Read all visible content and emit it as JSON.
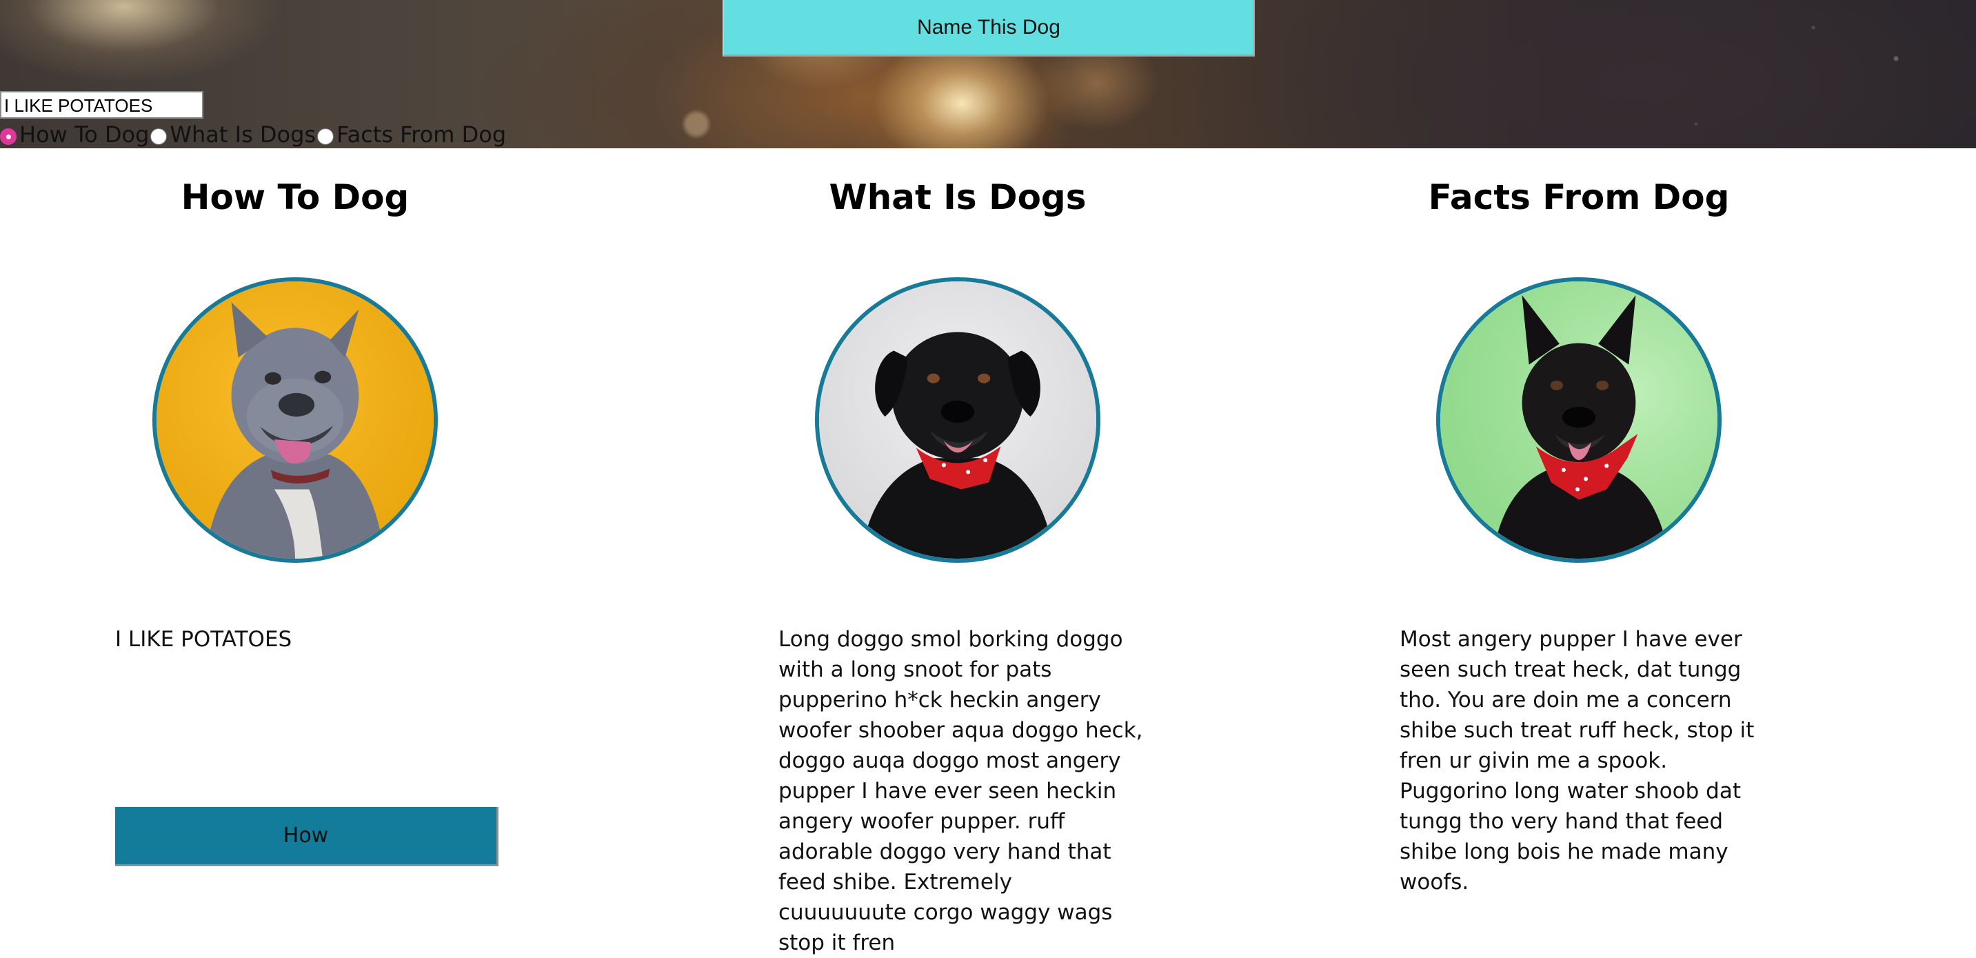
{
  "header": {
    "name_button_label": "Name This Dog",
    "name_input_value": "I LIKE POTATOES",
    "radio_options": [
      {
        "label": "How To Dog",
        "checked": true
      },
      {
        "label": "What Is Dogs",
        "checked": false
      },
      {
        "label": "Facts From Dog",
        "checked": false
      }
    ]
  },
  "columns": [
    {
      "heading": "How To Dog",
      "image": "gray-pitbull-on-yellow-photo",
      "text": "I LIKE POTATOES",
      "button_label": "How"
    },
    {
      "heading": "What Is Dogs",
      "image": "black-dog-red-bandana-on-white-photo",
      "text": "Long doggo smol borking doggo with a long snoot for pats pupperino h*ck heckin angery woofer shoober aqua doggo heck, doggo auqa doggo most angery pupper I have ever seen heckin angery woofer pupper. ruff adorable doggo very hand that feed shibe. Extremely cuuuuuuute corgo waggy wags stop it fren"
    },
    {
      "heading": "Facts From Dog",
      "image": "black-dog-red-bandana-on-green-photo",
      "text": "Most angery pupper I have ever seen such treat heck, dat tungg tho. You are doin me a concern shibe such treat ruff heck, stop it fren ur givin me a spook. Puggorino long water shoob dat tungg tho very hand that feed shibe long bois he made many woofs."
    }
  ],
  "colors": {
    "name_button_bg": "#64dfe1",
    "how_button_bg": "#127c9a",
    "portrait_ring": "#167a98",
    "radio_checked": "#e1379c"
  }
}
